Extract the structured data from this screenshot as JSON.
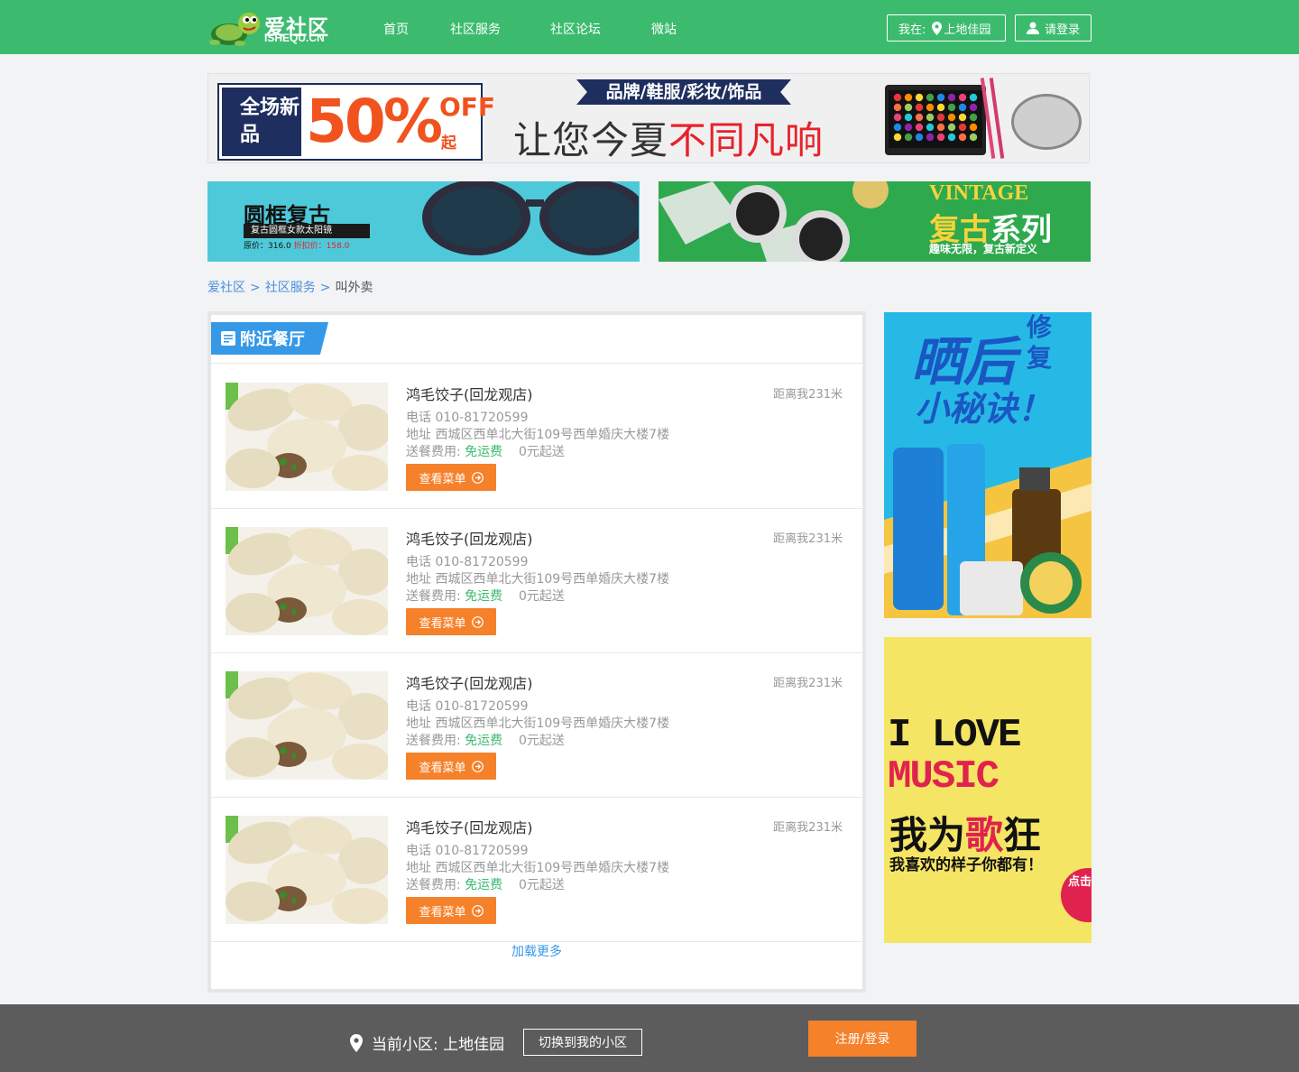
{
  "header": {
    "logo_cn": "爱社区",
    "logo_en": "ISHEQU.CN",
    "nav": [
      "首页",
      "社区服务",
      "社区论坛",
      "微站"
    ],
    "location_prefix": "我在:",
    "location_name": "上地佳园",
    "login_label": "请登录"
  },
  "banner_top": {
    "sale_tag": "全场新品",
    "sale_percent": "50%",
    "sale_off": "OFF",
    "sale_from": "起",
    "brand_line": "品牌/鞋服/彩妆/饰品",
    "slogan_a": "让您今夏",
    "slogan_b": "不同凡响"
  },
  "banner_left": {
    "title": "圆框复古",
    "subtitle": "复古圆框女款太阳镜",
    "price_orig": "原价：316.0",
    "price_sale": "折扣价：158.0"
  },
  "banner_right": {
    "en": "VINTAGE",
    "title_a": "复古",
    "title_b": "系列",
    "subtitle": "趣味无限，复古新定义"
  },
  "breadcrumb": {
    "home": "爱社区",
    "section": "社区服务",
    "sep": ">",
    "current": "叫外卖"
  },
  "panel": {
    "tab_title": "附近餐厅",
    "load_more": "加载更多"
  },
  "restaurants": [
    {
      "name": "鸿毛饺子(回龙观店)",
      "distance": "距离我231米",
      "phone": "电话 010-81720599",
      "address": "地址 西城区西单北大街109号西单婚庆大楼7楼",
      "fee_label": "送餐费用:",
      "fee_value": "免运费",
      "min_order": "0元起送",
      "button": "查看菜单"
    },
    {
      "name": "鸿毛饺子(回龙观店)",
      "distance": "距离我231米",
      "phone": "电话 010-81720599",
      "address": "地址 西城区西单北大街109号西单婚庆大楼7楼",
      "fee_label": "送餐费用:",
      "fee_value": "免运费",
      "min_order": "0元起送",
      "button": "查看菜单"
    },
    {
      "name": "鸿毛饺子(回龙观店)",
      "distance": "距离我231米",
      "phone": "电话 010-81720599",
      "address": "地址 西城区西单北大街109号西单婚庆大楼7楼",
      "fee_label": "送餐费用:",
      "fee_value": "免运费",
      "min_order": "0元起送",
      "button": "查看菜单"
    },
    {
      "name": "鸿毛饺子(回龙观店)",
      "distance": "距离我231米",
      "phone": "电话 010-81720599",
      "address": "地址 西城区西单北大街109号西单婚庆大楼7楼",
      "fee_label": "送餐费用:",
      "fee_value": "免运费",
      "min_order": "0元起送",
      "button": "查看菜单"
    }
  ],
  "side_ad1": {
    "title_a": "晒后",
    "title_b": "修复",
    "title_c": "小秘诀！"
  },
  "side_ad2": {
    "line1": "I LOVE",
    "line2": "MUSIC",
    "line3_a": "我为",
    "line3_b": "歌",
    "line3_c": "狂",
    "line4": "我喜欢的样子你都有！",
    "badge": "点击查看"
  },
  "footer": {
    "community_label": "当前小区: 上地佳园",
    "switch_label": "切换到我的小区",
    "register_label": "注册/登录"
  },
  "colors": {
    "brand_green": "#3cbb6f",
    "accent_blue": "#3699e8",
    "button_orange": "#f5812a",
    "footer_gray": "#5c5c5c"
  }
}
